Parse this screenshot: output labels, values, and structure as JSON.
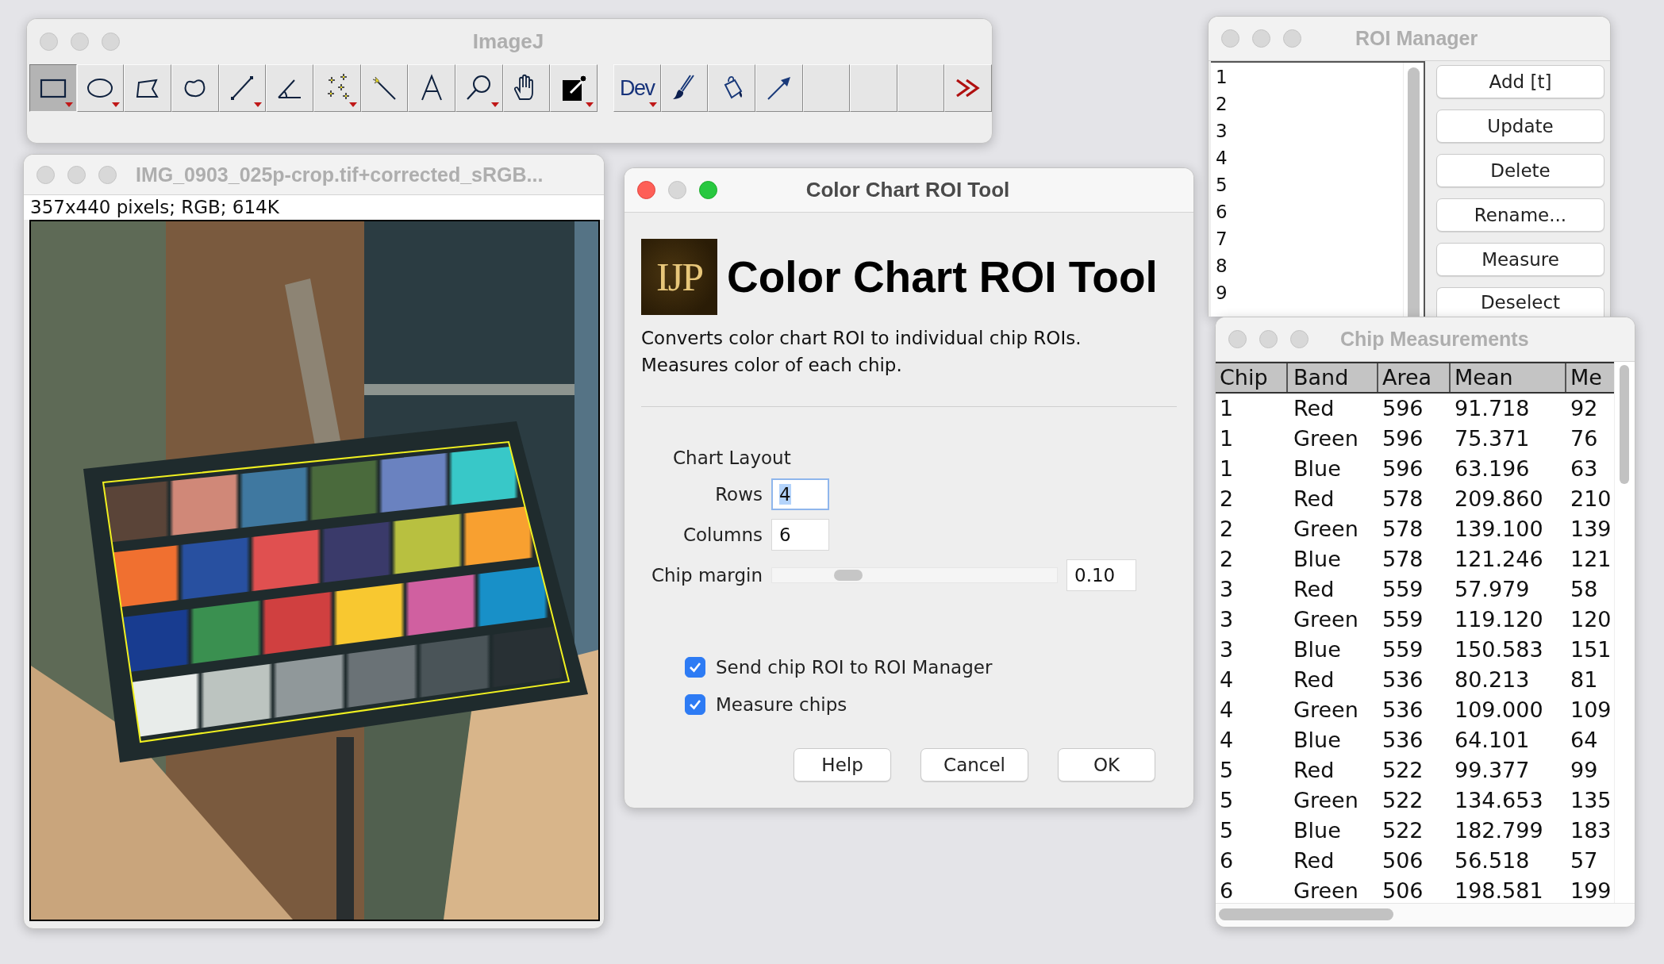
{
  "imagej": {
    "title": "ImageJ",
    "active": false,
    "tools": [
      {
        "kind": "rectangle",
        "selected": true,
        "menu": true
      },
      {
        "kind": "oval",
        "selected": false,
        "menu": true
      },
      {
        "kind": "polygon",
        "selected": false,
        "menu": false
      },
      {
        "kind": "freehand",
        "selected": false,
        "menu": false
      },
      {
        "kind": "line",
        "selected": false,
        "menu": true
      },
      {
        "kind": "angle",
        "selected": false,
        "menu": false
      },
      {
        "kind": "point",
        "selected": false,
        "menu": true
      },
      {
        "kind": "wand",
        "selected": false,
        "menu": false
      },
      {
        "kind": "text",
        "selected": false,
        "menu": false
      },
      {
        "kind": "zoom",
        "selected": false,
        "menu": true
      },
      {
        "kind": "hand",
        "selected": false,
        "menu": false
      },
      {
        "kind": "picker",
        "selected": false,
        "menu": true
      },
      {
        "kind": "separator"
      },
      {
        "kind": "label",
        "label": "Dev",
        "selected": false,
        "menu": true
      },
      {
        "kind": "brush",
        "selected": false,
        "menu": false
      },
      {
        "kind": "bucket",
        "selected": false,
        "menu": false
      },
      {
        "kind": "arrow",
        "selected": false,
        "menu": false
      },
      {
        "kind": "empty"
      },
      {
        "kind": "empty"
      },
      {
        "kind": "empty"
      },
      {
        "kind": "more"
      }
    ]
  },
  "image_window": {
    "title": "IMG_0903_025p-crop.tif+corrected_sRGB...",
    "active": false,
    "info": "357x440 pixels; RGB; 614K"
  },
  "dialog": {
    "title": "Color Chart ROI Tool",
    "active": true,
    "logo": "IJP",
    "heading": "Color Chart ROI Tool",
    "description": [
      "Converts color chart ROI to individual chip ROIs.",
      "Measures color of each chip."
    ],
    "section": "Chart Layout",
    "fields": [
      {
        "label": "Rows",
        "value": "4",
        "focused": true
      },
      {
        "label": "Columns",
        "value": "6",
        "focused": false
      }
    ],
    "slider": {
      "label": "Chip margin",
      "level": 0.24,
      "value": "0.10"
    },
    "checkboxes": [
      {
        "label": "Send chip ROI to ROI Manager",
        "checked": true
      },
      {
        "label": "Measure chips",
        "checked": true
      }
    ],
    "buttons": [
      "Help",
      "Cancel",
      "OK"
    ]
  },
  "roi_manager": {
    "title": "ROI Manager",
    "active": false,
    "items": [
      "1",
      "2",
      "3",
      "4",
      "5",
      "6",
      "7",
      "8",
      "9"
    ],
    "buttons": [
      "Add [t]",
      "Update",
      "Delete",
      "Rename...",
      "Measure",
      "Deselect"
    ]
  },
  "chip_window": {
    "title": "Chip Measurements",
    "active": false,
    "columns": [
      "Chip",
      "Band",
      "Area",
      "Mean",
      "Me"
    ],
    "rows": [
      [
        "1",
        "Red",
        "596",
        "91.718",
        "92"
      ],
      [
        "1",
        "Green",
        "596",
        "75.371",
        "76"
      ],
      [
        "1",
        "Blue",
        "596",
        "63.196",
        "63"
      ],
      [
        "2",
        "Red",
        "578",
        "209.860",
        "210"
      ],
      [
        "2",
        "Green",
        "578",
        "139.100",
        "139"
      ],
      [
        "2",
        "Blue",
        "578",
        "121.246",
        "121"
      ],
      [
        "3",
        "Red",
        "559",
        "57.979",
        "58"
      ],
      [
        "3",
        "Green",
        "559",
        "119.120",
        "120"
      ],
      [
        "3",
        "Blue",
        "559",
        "150.583",
        "151"
      ],
      [
        "4",
        "Red",
        "536",
        "80.213",
        "81"
      ],
      [
        "4",
        "Green",
        "536",
        "109.000",
        "109"
      ],
      [
        "4",
        "Blue",
        "536",
        "64.101",
        "64"
      ],
      [
        "5",
        "Red",
        "522",
        "99.377",
        "99"
      ],
      [
        "5",
        "Green",
        "522",
        "134.653",
        "135"
      ],
      [
        "5",
        "Blue",
        "522",
        "182.799",
        "183"
      ],
      [
        "6",
        "Red",
        "506",
        "56.518",
        "57"
      ],
      [
        "6",
        "Green",
        "506",
        "198.581",
        "199"
      ]
    ]
  }
}
